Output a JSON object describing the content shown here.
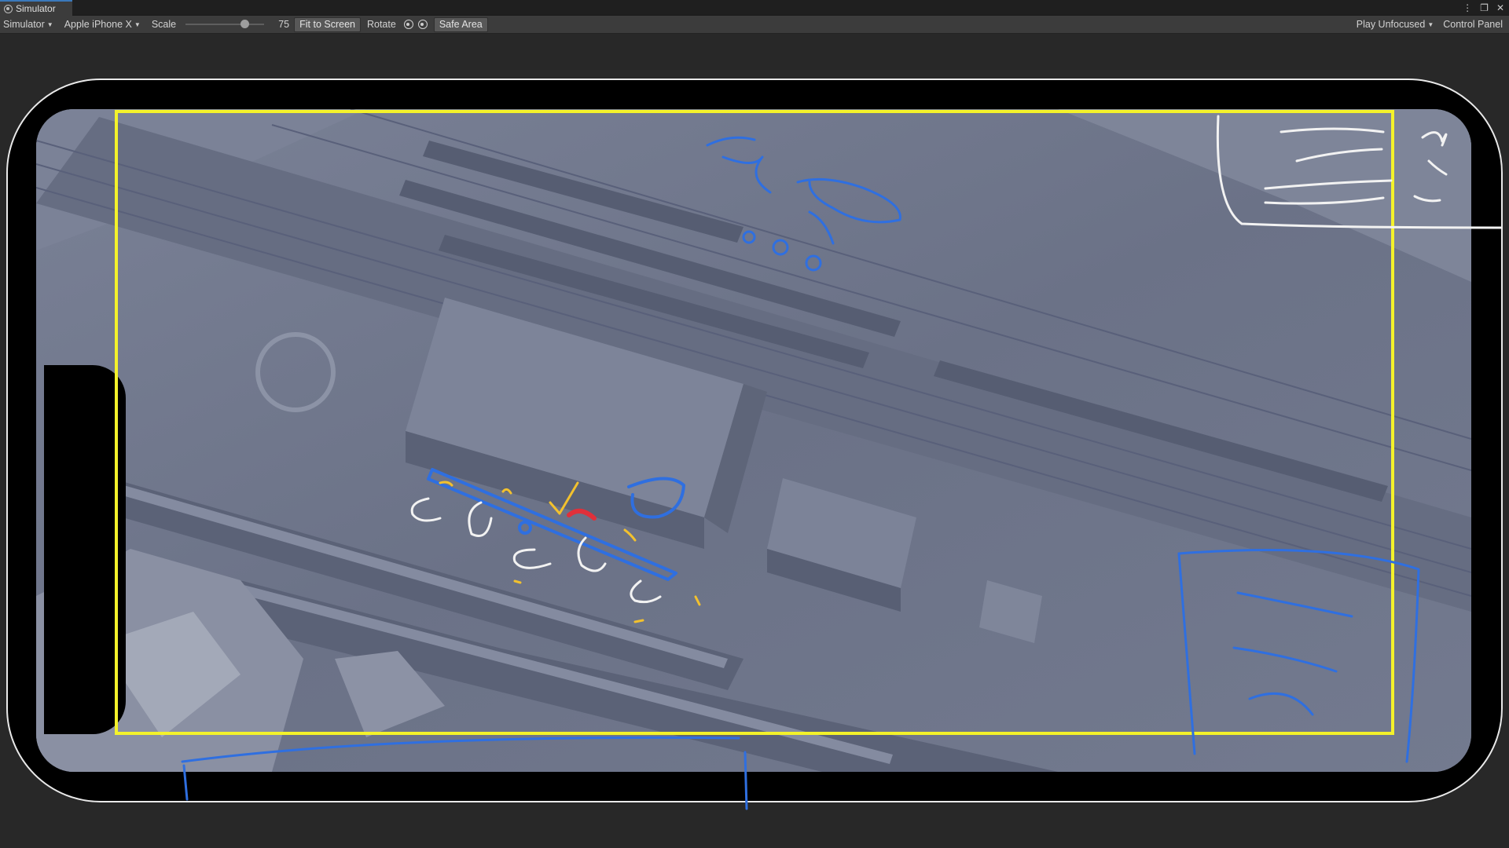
{
  "window": {
    "tab_title": "Simulator",
    "controls": [
      "⋮",
      "❐",
      "✕"
    ]
  },
  "toolbar": {
    "mode_label": "Simulator",
    "device_label": "Apple iPhone X",
    "scale_label": "Scale",
    "scale_value": "75",
    "scale_fraction": 0.75,
    "fit_to_screen_label": "Fit to Screen",
    "rotate_label": "Rotate",
    "safe_area_label": "Safe Area",
    "play_mode_label": "Play Unfocused",
    "control_panel_label": "Control Panel"
  },
  "colors": {
    "safe_area": "#f4f22a",
    "scene_ground": "#6c7488",
    "ink_blue": "#2f6fe0",
    "ink_white": "#f2f2f2",
    "ink_yellow": "#f2c12e",
    "ink_red": "#e0303a"
  },
  "icons": {
    "tab": "simulator-tab-icon",
    "rotate_left": "rotate-counterclockwise-icon",
    "rotate_right": "rotate-clockwise-icon"
  }
}
